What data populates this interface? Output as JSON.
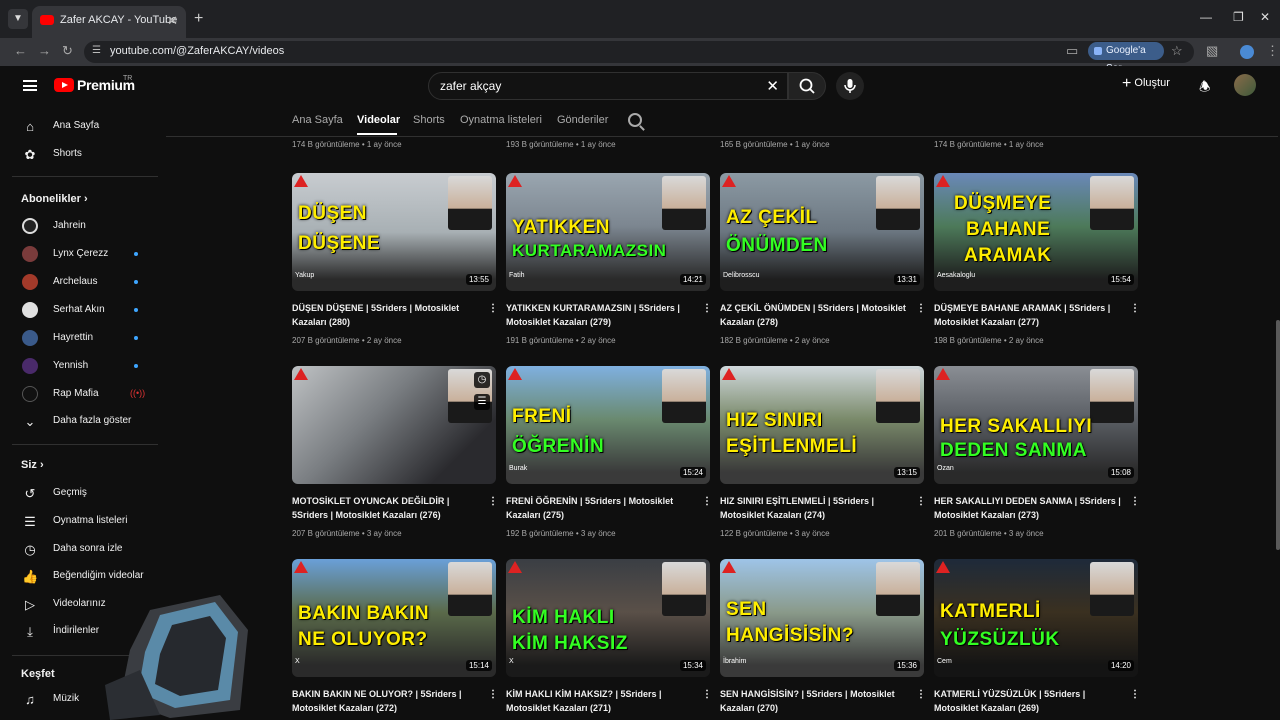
{
  "browser": {
    "tab_title": "Zafer AKCAY - YouTube",
    "url": "youtube.com/@ZaferAKCAY/videos",
    "google_btn": "Google'a Sor"
  },
  "header": {
    "logo": "Premium",
    "region": "TR",
    "search_value": "zafer akçay",
    "create_label": "Oluştur"
  },
  "sidebar": {
    "home": "Ana Sayfa",
    "shorts": "Shorts",
    "subs_heading": "Abonelikler",
    "channels": [
      "Jahrein",
      "Lynx Çerezz",
      "Archelaus",
      "Serhat Akın",
      "Hayrettin",
      "Yennish",
      "Rap Mafia"
    ],
    "show_more": "Daha fazla göster",
    "you_heading": "Siz",
    "you_items": [
      "Geçmiş",
      "Oynatma listeleri",
      "Daha sonra izle",
      "Beğendiğim videolar",
      "Videolarınız",
      "İndirilenler"
    ],
    "explore_heading": "Keşfet",
    "music": "Müzik"
  },
  "tabs": [
    "Ana Sayfa",
    "Videolar",
    "Shorts",
    "Oynatma listeleri",
    "Gönderiler"
  ],
  "top_meta": [
    "174 B görüntüleme • 1 ay önce",
    "193 B görüntüleme • 1 ay önce",
    "165 B görüntüleme • 1 ay önce",
    "174 B görüntüleme • 1 ay önce"
  ],
  "videos": [
    {
      "thumb1": "DÜŞEN",
      "thumb2": "DÜŞENE",
      "rider": "Yakup",
      "duration": "13:55",
      "title": "DÜŞEN DÜŞENE | 5Sriders | Motosiklet Kazaları (280)",
      "meta": "207 B görüntüleme • 2 ay önce"
    },
    {
      "thumb1": "YATIKKEN",
      "thumb2": "KURTARAMAZSIN",
      "rider": "Fatih",
      "duration": "14:21",
      "title": "YATIKKEN KURTARAMAZSIN | 5Sriders | Motosiklet Kazaları (279)",
      "meta": "191 B görüntüleme • 2 ay önce"
    },
    {
      "thumb1": "AZ ÇEKİL",
      "thumb2": "ÖNÜMDEN",
      "rider": "Delibrosscu",
      "duration": "13:31",
      "title": "AZ ÇEKİL ÖNÜMDEN | 5Sriders | Motosiklet Kazaları (278)",
      "meta": "182 B görüntüleme • 2 ay önce"
    },
    {
      "thumb1": "DÜŞMEYE",
      "thumb2": "BAHANE",
      "thumb3": "ARAMAK",
      "rider": "Aesakaloglu",
      "duration": "15:54",
      "title": "DÜŞMEYE BAHANE ARAMAK | 5Sriders | Motosiklet Kazaları (277)",
      "meta": "198 B görüntüleme • 2 ay önce"
    },
    {
      "thumb1": "",
      "thumb2": "",
      "rider": "",
      "duration": "",
      "title": "MOTOSİKLET OYUNCAK DEĞİLDİR | 5Sriders | Motosiklet Kazaları (276)",
      "meta": "207 B görüntüleme • 3 ay önce"
    },
    {
      "thumb1": "FRENİ",
      "thumb2": "ÖĞRENİN",
      "rider": "Burak",
      "duration": "15:24",
      "title": "FRENİ ÖĞRENİN | 5Sriders | Motosiklet Kazaları (275)",
      "meta": "192 B görüntüleme • 3 ay önce"
    },
    {
      "thumb1": "HIZ SINIRI",
      "thumb2": "EŞİTLENMELİ",
      "rider": "",
      "duration": "13:15",
      "title": "HIZ SINIRI EŞİTLENMELİ | 5Sriders | Motosiklet Kazaları (274)",
      "meta": "122 B görüntüleme • 3 ay önce"
    },
    {
      "thumb1": "HER SAKALLIYI",
      "thumb2": "DEDEN SANMA",
      "rider": "Ozan",
      "duration": "15:08",
      "title": "HER SAKALLIYI DEDEN SANMA | 5Sriders | Motosiklet Kazaları (273)",
      "meta": "201 B görüntüleme • 3 ay önce"
    },
    {
      "thumb1": "BAKIN BAKIN",
      "thumb2": "NE OLUYOR?",
      "rider": "X",
      "duration": "15:14",
      "title": "BAKIN BAKIN NE OLUYOR? | 5Sriders | Motosiklet Kazaları (272)",
      "meta": ""
    },
    {
      "thumb1": "KİM HAKLI",
      "thumb2": "KİM HAKSIZ",
      "rider": "X",
      "duration": "15:34",
      "title": "KİM HAKLI KİM HAKSIZ? | 5Sriders | Motosiklet Kazaları (271)",
      "meta": ""
    },
    {
      "thumb1": "SEN",
      "thumb2": "HANGİSİSİN?",
      "rider": "İbrahim",
      "duration": "15:36",
      "title": "SEN HANGİSİSİN? | 5Sriders | Motosiklet Kazaları (270)",
      "meta": ""
    },
    {
      "thumb1": "KATMERLİ",
      "thumb2": "YÜZSÜZLÜK",
      "rider": "Cem",
      "duration": "14:20",
      "title": "KATMERLİ YÜZSÜZLÜK | 5Sriders | Motosiklet Kazaları (269)",
      "meta": ""
    }
  ]
}
